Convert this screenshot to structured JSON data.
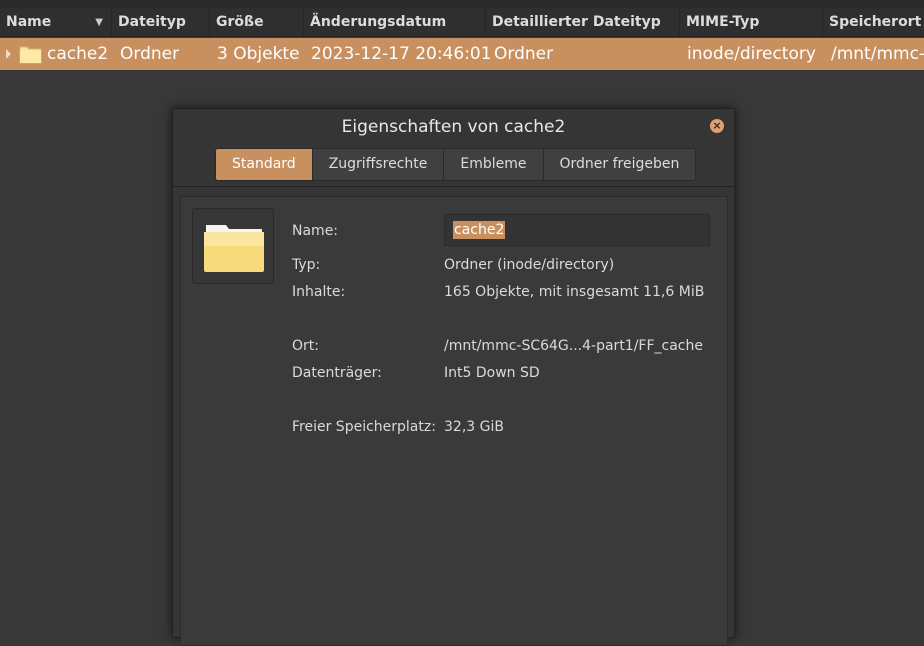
{
  "columns": [
    "Name",
    "Dateityp",
    "Größe",
    "Änderungsdatum",
    "Detaillierter Dateityp",
    "MIME-Typ",
    "Speicherort"
  ],
  "row": {
    "name": "cache2",
    "type": "Ordner",
    "size": "3 Objekte",
    "modified": "2023-12-17 20:46:01",
    "detailed_type": "Ordner",
    "mime": "inode/directory",
    "location": "/mnt/mmc-"
  },
  "dialog": {
    "title": "Eigenschaften von cache2",
    "tabs": [
      "Standard",
      "Zugriffsrechte",
      "Embleme",
      "Ordner freigeben"
    ],
    "close_icon": "×",
    "fields": {
      "name_label": "Name:",
      "name_value": "cache2",
      "type_label": "Typ:",
      "type_value": "Ordner (inode/directory)",
      "contents_label": "Inhalte:",
      "contents_value": "165 Objekte, mit insgesamt 11,6 MiB",
      "location_label": "Ort:",
      "location_value": "/mnt/mmc-SC64G...4-part1/FF_cache",
      "volume_label": "Datenträger:",
      "volume_value": "Int5 Down SD",
      "free_label": "Freier Speicherplatz:",
      "free_value": "32,3 GiB"
    }
  },
  "colors": {
    "accent": "#c8905e",
    "background": "#383838",
    "dialog": "#353535"
  }
}
